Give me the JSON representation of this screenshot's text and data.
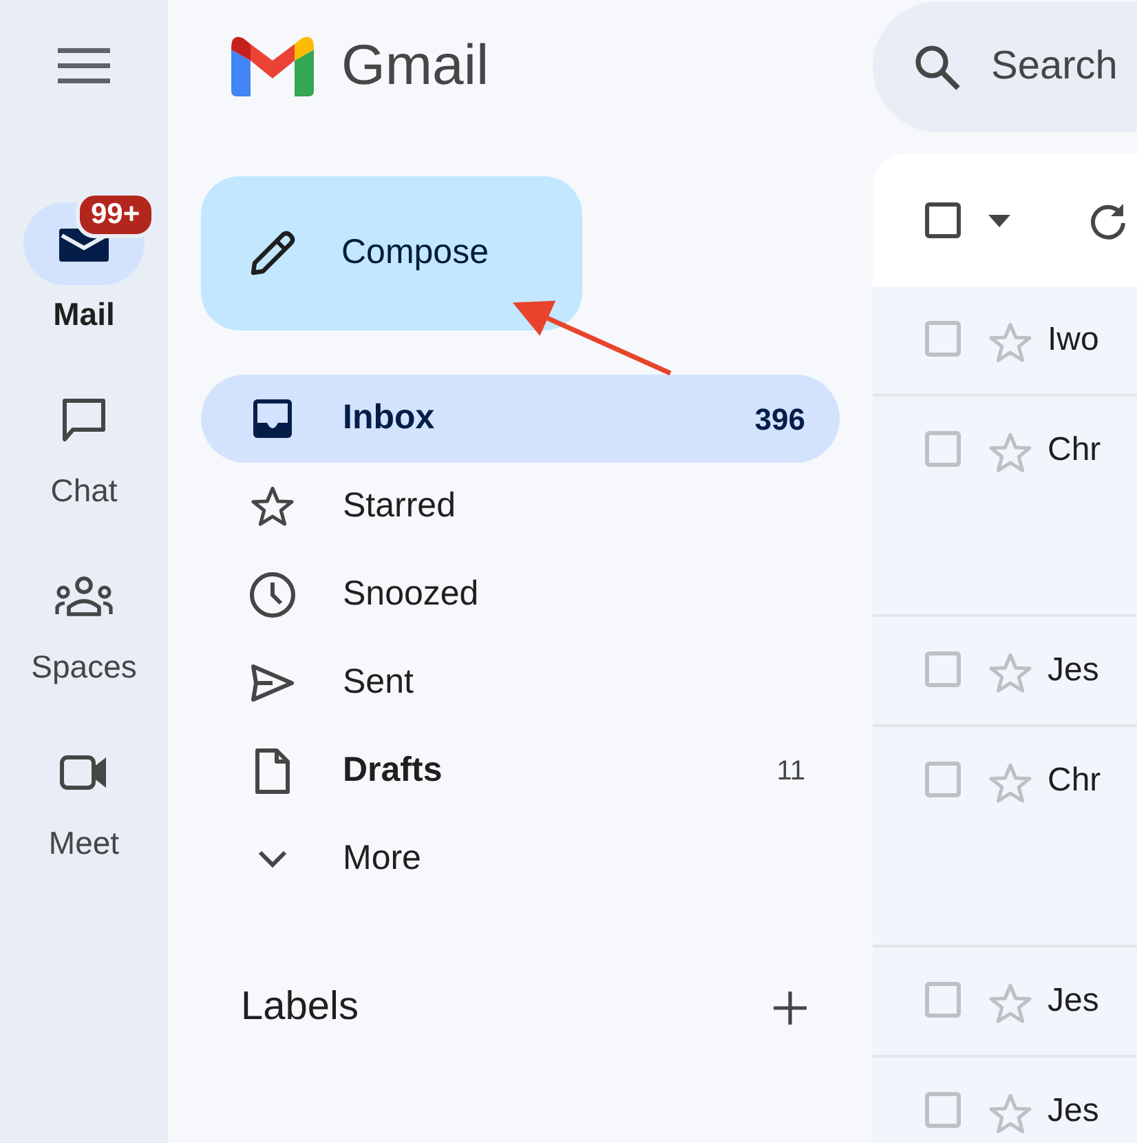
{
  "rail": {
    "items": [
      {
        "kind": "mail",
        "label": "Mail",
        "badge": "99+",
        "selected": true
      },
      {
        "kind": "chat",
        "label": "Chat",
        "selected": false
      },
      {
        "kind": "spaces",
        "label": "Spaces",
        "selected": false
      },
      {
        "kind": "meet",
        "label": "Meet",
        "selected": false
      }
    ]
  },
  "header": {
    "product": "Gmail"
  },
  "compose": {
    "label": "Compose"
  },
  "folders": [
    {
      "kind": "inbox",
      "label": "Inbox",
      "count": "396",
      "selected": true,
      "unread": true
    },
    {
      "kind": "starred",
      "label": "Starred",
      "selected": false,
      "unread": false
    },
    {
      "kind": "snoozed",
      "label": "Snoozed",
      "selected": false,
      "unread": false
    },
    {
      "kind": "sent",
      "label": "Sent",
      "selected": false,
      "unread": false
    },
    {
      "kind": "drafts",
      "label": "Drafts",
      "count": "11",
      "selected": false,
      "unread": true
    },
    {
      "kind": "more",
      "label": "More",
      "selected": false,
      "unread": false
    }
  ],
  "labels": {
    "title": "Labels"
  },
  "search": {
    "placeholder": "Search"
  },
  "toolbar": {
    "select_all_checked": false
  },
  "messages": [
    {
      "sender": "Iwo",
      "checked": false,
      "starred": false
    },
    {
      "sender": "Chr",
      "checked": false,
      "starred": false
    },
    {
      "sender": "Jes",
      "checked": false,
      "starred": false
    },
    {
      "sender": "Chr",
      "checked": false,
      "starred": false
    },
    {
      "sender": "Jes",
      "checked": false,
      "starred": false
    },
    {
      "sender": "Jes",
      "checked": false,
      "starred": false
    }
  ]
}
